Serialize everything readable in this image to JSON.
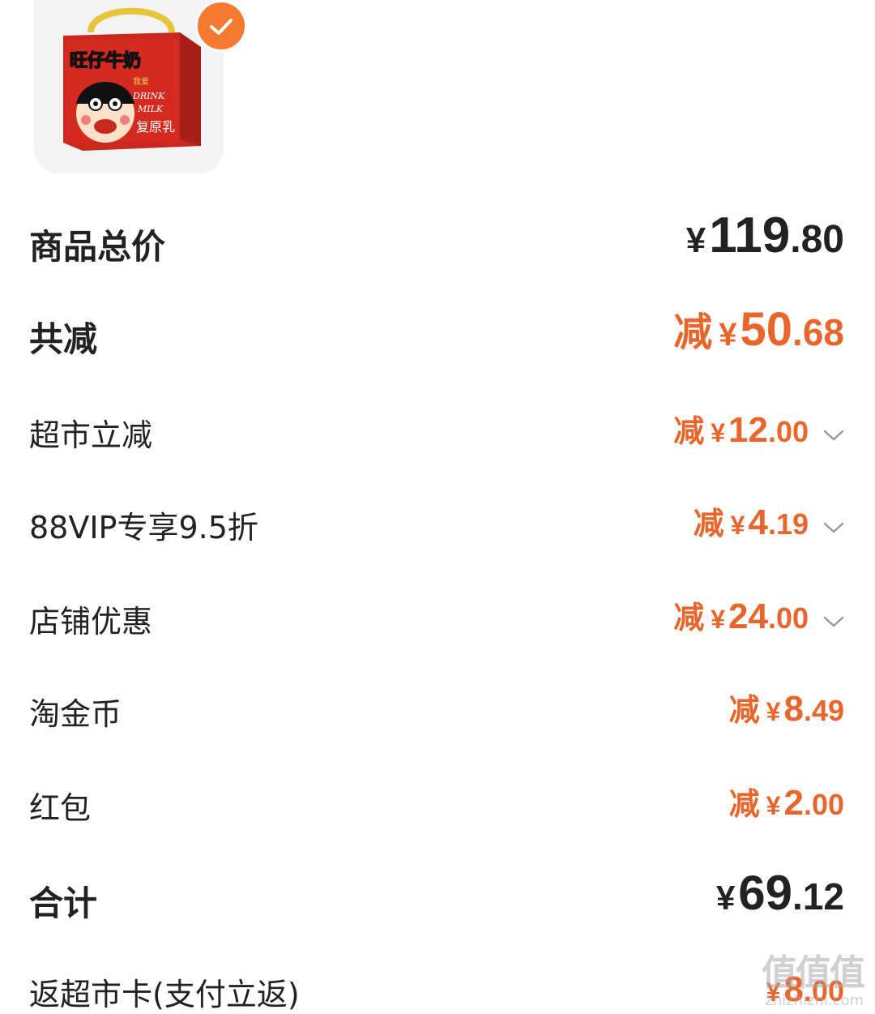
{
  "product": {
    "image_text": [
      "旺仔牛奶",
      "我爱",
      "DRINK",
      "MILK",
      "复原乳"
    ],
    "selected": true
  },
  "summary": {
    "rows": [
      {
        "label": "商品总价",
        "prefix": "",
        "yen": "¥",
        "int": "119",
        "dec": ".80",
        "style": "dark",
        "has_chevron": false
      },
      {
        "label": "共减",
        "prefix": "减",
        "yen": "¥",
        "int": "50",
        "dec": ".68",
        "style": "orange",
        "has_chevron": false
      },
      {
        "label": "超市立减",
        "prefix": "减",
        "yen": "¥",
        "int": "12",
        "dec": ".00",
        "style": "orange",
        "has_chevron": true
      },
      {
        "label": "88VIP专享9.5折",
        "prefix": "减",
        "yen": "¥",
        "int": "4",
        "dec": ".19",
        "style": "orange",
        "has_chevron": true
      },
      {
        "label": "店铺优惠",
        "prefix": "减",
        "yen": "¥",
        "int": "24",
        "dec": ".00",
        "style": "orange",
        "has_chevron": true
      },
      {
        "label": "淘金币",
        "prefix": "减",
        "yen": "¥",
        "int": "8",
        "dec": ".49",
        "style": "orange",
        "has_chevron": false
      },
      {
        "label": "红包",
        "prefix": "减",
        "yen": "¥",
        "int": "2",
        "dec": ".00",
        "style": "orange",
        "has_chevron": false
      },
      {
        "label": "合计",
        "prefix": "",
        "yen": "¥",
        "int": "69",
        "dec": ".12",
        "style": "dark",
        "has_chevron": false
      },
      {
        "label": "返超市卡(支付立返)",
        "prefix": "",
        "yen": "¥",
        "int": "8",
        "dec": ".00",
        "style": "orange",
        "has_chevron": false
      }
    ]
  },
  "watermark": {
    "line1": "值值值",
    "line2": "zhizhizhi.com"
  },
  "colors": {
    "accent": "#e8652b",
    "check": "#f5792f",
    "text": "#222222"
  },
  "icons": {
    "check": "check-icon",
    "chevron": "chevron-down-icon"
  }
}
